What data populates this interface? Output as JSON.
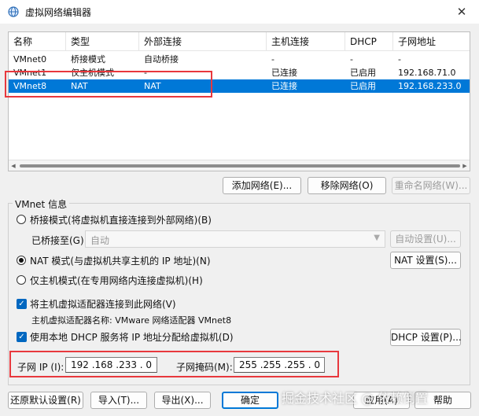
{
  "window": {
    "title": "虚拟网络编辑器",
    "close_glyph": "✕"
  },
  "table": {
    "headers": [
      "名称",
      "类型",
      "外部连接",
      "主机连接",
      "DHCP",
      "子网地址"
    ],
    "rows": [
      [
        "VMnet0",
        "桥接模式",
        "自动桥接",
        "-",
        "-",
        "-"
      ],
      [
        "VMnet1",
        "仅主机模式",
        "-",
        "已连接",
        "已启用",
        "192.168.71.0"
      ],
      [
        "VMnet8",
        "NAT",
        "NAT",
        "已连接",
        "已启用",
        "192.168.233.0"
      ]
    ],
    "selected_row": 2
  },
  "list_buttons": {
    "add": "添加网络(E)...",
    "remove": "移除网络(O)",
    "rename": "重命名网络(W)..."
  },
  "vmnet_info": {
    "title": "VMnet 信息",
    "bridged": "桥接模式(将虚拟机直接连接到外部网络)(B)",
    "bridged_to_label": "已桥接至(G):",
    "bridged_to_value": "自动",
    "auto_settings": "自动设置(U)...",
    "nat": "NAT 模式(与虚拟机共享主机的 IP 地址)(N)",
    "nat_settings": "NAT 设置(S)...",
    "host_only": "仅主机模式(在专用网络内连接虚拟机)(H)",
    "connect_adapter": "将主机虚拟适配器连接到此网络(V)",
    "adapter_name": "主机虚拟适配器名称: VMware 网络适配器 VMnet8",
    "use_dhcp": "使用本地 DHCP 服务将 IP 地址分配给虚拟机(D)",
    "dhcp_settings": "DHCP 设置(P)...",
    "subnet_ip_label": "子网 IP (I):",
    "subnet_ip": "192 .168 .233 . 0",
    "subnet_mask_label": "子网掩码(M):",
    "subnet_mask": "255 .255 .255 . 0",
    "mode_selected": "nat",
    "connect_adapter_checked": true,
    "use_dhcp_checked": true
  },
  "footer": {
    "restore": "还原默认设置(R)",
    "import": "导入(T)...",
    "export": "导出(X)...",
    "ok": "确定",
    "apply": "应用(A)",
    "help": "帮助"
  },
  "watermark": "掘金技术社区 @ 依赖倒置",
  "colors": {
    "selection": "#0078d7",
    "annotation": "#e8383d"
  }
}
